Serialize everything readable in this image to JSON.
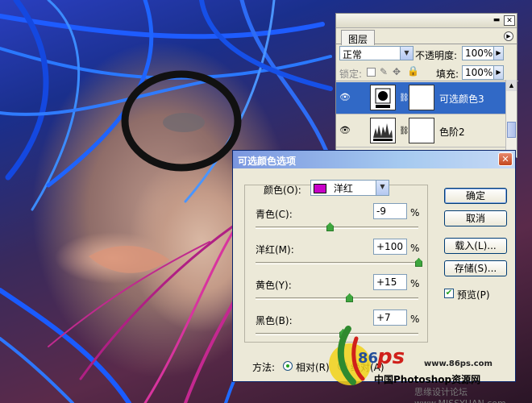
{
  "layers_panel": {
    "tab": "图层",
    "blend_mode": "正常",
    "opacity_label": "不透明度:",
    "opacity_value": "100%",
    "lock_label": "锁定:",
    "fill_label": "填充:",
    "fill_value": "100%",
    "layers": [
      {
        "name": "可选颜色3",
        "selected": true
      },
      {
        "name": "色阶2",
        "selected": false
      }
    ]
  },
  "dialog": {
    "title": "可选颜色选项",
    "color_label": "颜色(O):",
    "color_value": "洋红",
    "swatch_color": "#c800c8",
    "channels": [
      {
        "label": "青色(C):",
        "value": "-9",
        "unit": "%",
        "level": -9
      },
      {
        "label": "洋红(M):",
        "value": "+100",
        "unit": "%",
        "level": 100
      },
      {
        "label": "黄色(Y):",
        "value": "+15",
        "unit": "%",
        "level": 15
      },
      {
        "label": "黑色(B):",
        "value": "+7",
        "unit": "%",
        "level": 7
      }
    ],
    "buttons": {
      "ok": "确定",
      "cancel": "取消",
      "load": "载入(L)...",
      "save": "存储(S)..."
    },
    "preview_label": "预览(P)",
    "preview_checked": true,
    "method_label": "方法:",
    "method_relative": "相对(R)",
    "method_absolute": "绝对(A)",
    "method_selected": "relative"
  },
  "watermark": {
    "number": "86",
    "letter": "ps",
    "url": "www.86ps.com",
    "site": "中国Photoshop资源网",
    "credit": "思缘设计论坛 www.MISSYUAN.com"
  }
}
